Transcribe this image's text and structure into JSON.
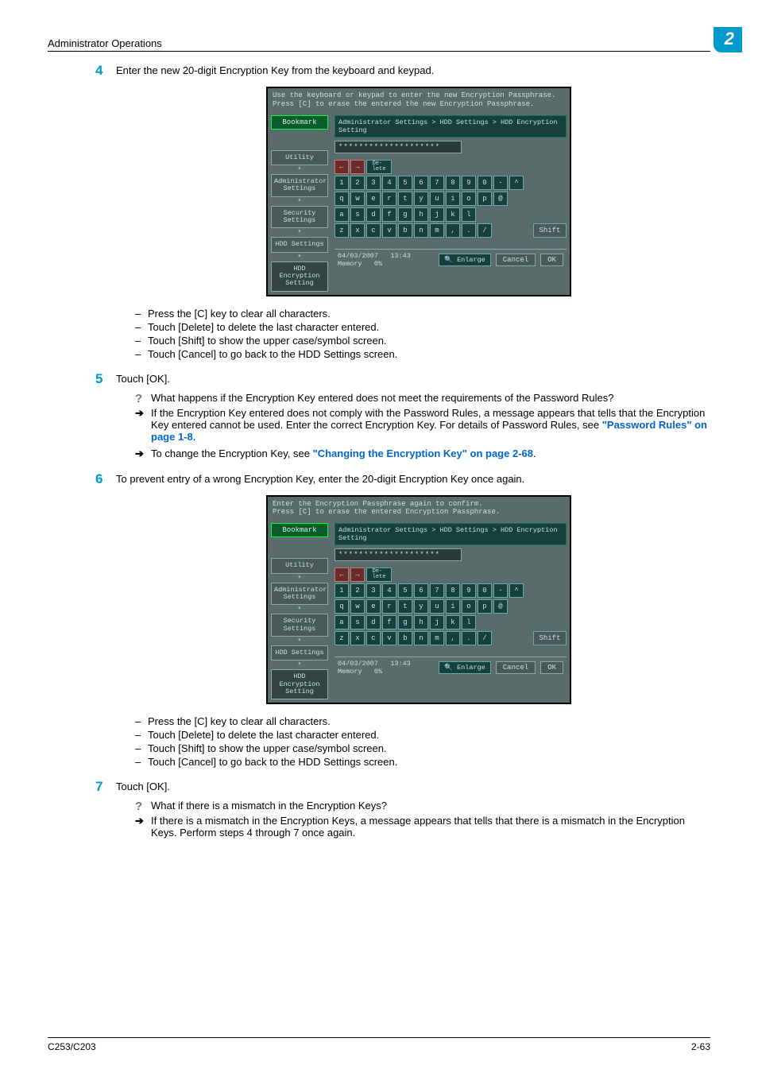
{
  "header": {
    "title": "Administrator Operations",
    "chapter": "2"
  },
  "footer": {
    "model": "C253/C203",
    "page": "2-63"
  },
  "step4": {
    "num": "4",
    "text": "Enter the new 20-digit Encryption Key from the keyboard and keypad.",
    "subs": [
      "Press the [C] key to clear all characters.",
      "Touch [Delete] to delete the last character entered.",
      "Touch [Shift] to show the upper case/symbol screen.",
      "Touch [Cancel] to go back to the HDD Settings screen."
    ]
  },
  "step5": {
    "num": "5",
    "text": "Touch [OK].",
    "q": "What happens if the Encryption Key entered does not meet the requirements of the Password Rules?",
    "a1_pre": "If the Encryption Key entered does not comply with the Password Rules, a message appears that tells that the Encryption Key entered cannot be used. Enter the correct Encryption Key. For details of Password Rules, see ",
    "a1_link": "\"Password Rules\" on page 1-8",
    "a2_pre": "To change the Encryption Key, see ",
    "a2_link": "\"Changing the Encryption Key\" on page 2-68"
  },
  "step6": {
    "num": "6",
    "text": "To prevent entry of a wrong Encryption Key, enter the 20-digit Encryption Key once again.",
    "subs": [
      "Press the [C] key to clear all characters.",
      "Touch [Delete] to delete the last character entered.",
      "Touch [Shift] to show the upper case/symbol screen.",
      "Touch [Cancel] to go back to the HDD Settings screen."
    ]
  },
  "step7": {
    "num": "7",
    "text": "Touch [OK].",
    "q": "What if there is a mismatch in the Encryption Keys?",
    "a": "If there is a mismatch in the Encryption Keys, a message appears that tells that there is a mismatch in the Encryption Keys. Perform steps 4 through 7 once again."
  },
  "panel": {
    "msg1a": "Use the keyboard or keypad to enter the new Encryption Passphrase.",
    "msg1b": "Press [C] to erase the entered the new Encryption Passphrase.",
    "msg2a": "Enter the Encryption Passphrase again to confirm.",
    "msg2b": "Press [C] to erase the entered Encryption Passphrase.",
    "bookmark": "Bookmark",
    "breadcrumb": "Administrator Settings > HDD Settings > HDD Encryption Setting",
    "entry": "********************",
    "side": [
      "Utility",
      "Administrator Settings",
      "Security Settings",
      "HDD Settings"
    ],
    "side_active": "HDD Encryption Setting",
    "delete": "De-\nlete",
    "shift": "Shift",
    "row1": [
      "1",
      "2",
      "3",
      "4",
      "5",
      "6",
      "7",
      "8",
      "9",
      "0",
      "-",
      "^"
    ],
    "row2": [
      "q",
      "w",
      "e",
      "r",
      "t",
      "y",
      "u",
      "i",
      "o",
      "p",
      "@"
    ],
    "row3": [
      "a",
      "s",
      "d",
      "f",
      "g",
      "h",
      "j",
      "k",
      "l"
    ],
    "row4": [
      "z",
      "x",
      "c",
      "v",
      "b",
      "n",
      "m",
      ",",
      ".",
      "/"
    ],
    "date": "04/03/2007",
    "time": "13:43",
    "mem": "Memory",
    "mem_v": "0%",
    "enlarge": "Enlarge",
    "cancel": "Cancel",
    "ok": "OK"
  }
}
